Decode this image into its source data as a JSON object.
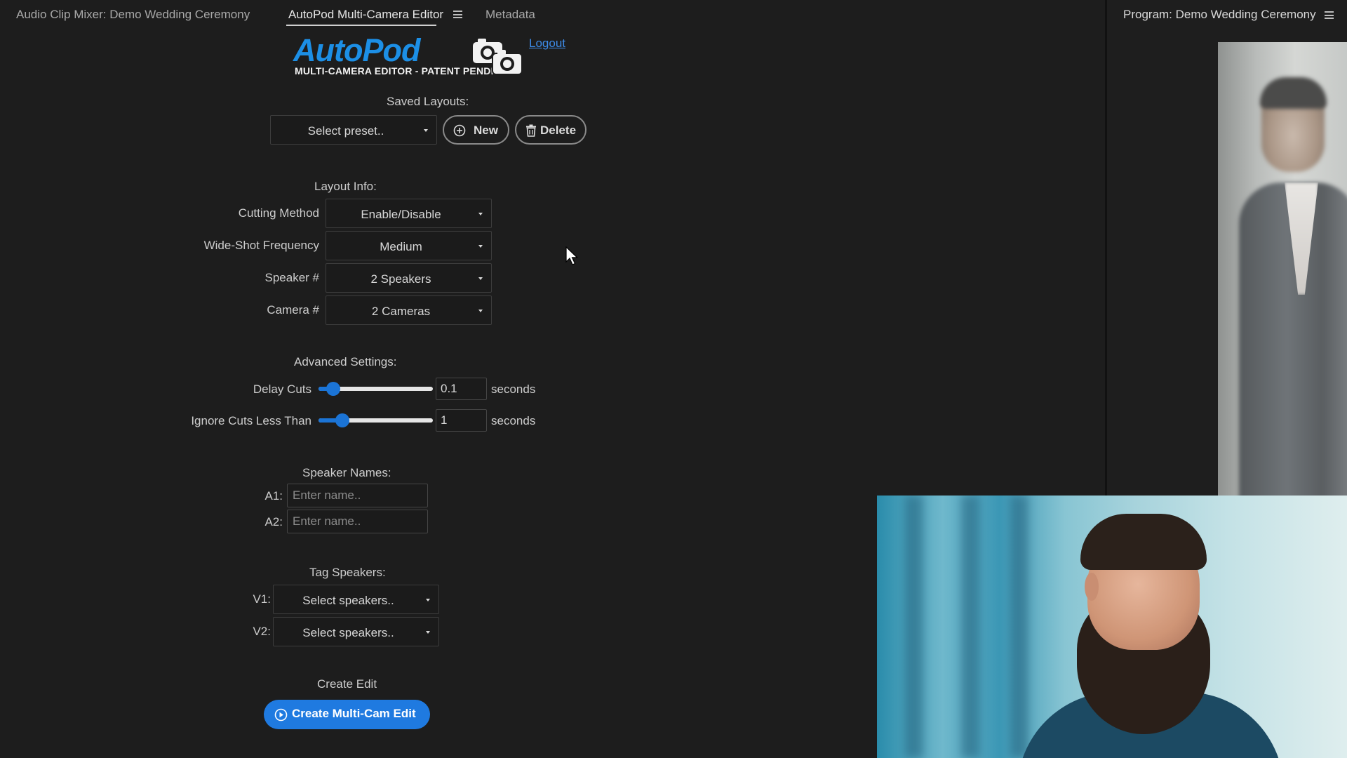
{
  "tabs": {
    "audio_mixer": "Audio Clip Mixer: Demo Wedding Ceremony",
    "autopod_editor": "AutoPod Multi-Camera Editor",
    "metadata": "Metadata"
  },
  "program": {
    "title": "Program: Demo Wedding Ceremony"
  },
  "logo": {
    "wordmark": "AutoPod",
    "subtitle": "MULTI-CAMERA EDITOR - PATENT PENDING",
    "icon": "camera-icon"
  },
  "header": {
    "logout_label": "Logout"
  },
  "saved_layouts": {
    "heading": "Saved Layouts:",
    "preset_value": "Select preset..",
    "new_label": "New",
    "delete_label": "Delete"
  },
  "layout_info": {
    "heading": "Layout Info:",
    "fields": [
      {
        "label": "Cutting Method",
        "value": "Enable/Disable"
      },
      {
        "label": "Wide-Shot Frequency",
        "value": "Medium"
      },
      {
        "label": "Speaker #",
        "value": "2 Speakers"
      },
      {
        "label": "Camera #",
        "value": "2 Cameras"
      }
    ]
  },
  "advanced": {
    "heading": "Advanced Settings:",
    "delay_cuts": {
      "label": "Delay Cuts",
      "value": "0.1",
      "unit": "seconds",
      "slider_fraction": 0.08
    },
    "ignore_cuts": {
      "label": "Ignore Cuts Less Than",
      "value": "1",
      "unit": "seconds",
      "slider_fraction": 0.17
    }
  },
  "speaker_names": {
    "heading": "Speaker Names:",
    "rows": [
      {
        "label": "A1:",
        "placeholder": "Enter name.."
      },
      {
        "label": "A2:",
        "placeholder": "Enter name.."
      }
    ]
  },
  "tag_speakers": {
    "heading": "Tag Speakers:",
    "rows": [
      {
        "label": "V1:",
        "value": "Select speakers.."
      },
      {
        "label": "V2:",
        "value": "Select speakers.."
      }
    ]
  },
  "create": {
    "heading": "Create Edit",
    "button_label": "Create Multi-Cam Edit"
  },
  "colors": {
    "accent": "#1f7ae0",
    "logo_blue": "#1c8fe6",
    "link": "#3d8be8",
    "background": "#1d1d1d"
  }
}
